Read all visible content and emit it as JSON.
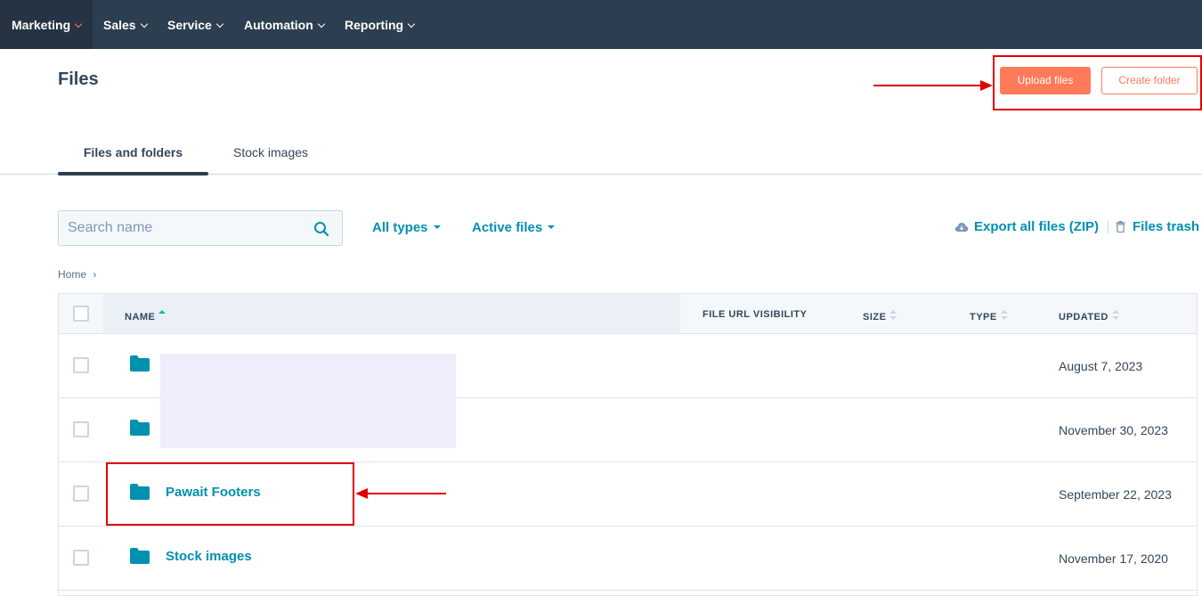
{
  "nav": {
    "items": [
      {
        "label": "Marketing"
      },
      {
        "label": "Sales"
      },
      {
        "label": "Service"
      },
      {
        "label": "Automation"
      },
      {
        "label": "Reporting"
      }
    ]
  },
  "header": {
    "title": "Files",
    "upload_label": "Upload files",
    "create_folder_label": "Create folder"
  },
  "tabs": [
    {
      "label": "Files and folders",
      "active": true
    },
    {
      "label": "Stock images",
      "active": false
    }
  ],
  "toolbar": {
    "search_placeholder": "Search name",
    "type_filter": "All types",
    "status_filter": "Active files",
    "export_label": "Export all files (ZIP)",
    "trash_label": "Files trash"
  },
  "breadcrumb": {
    "home": "Home",
    "separator": "›"
  },
  "table": {
    "columns": {
      "name": "NAME",
      "visibility": "FILE URL VISIBILITY",
      "size": "SIZE",
      "type": "TYPE",
      "updated": "UPDATED"
    },
    "rows": [
      {
        "name": "",
        "updated": "August 7, 2023"
      },
      {
        "name": "",
        "updated": "November 30, 2023"
      },
      {
        "name": "Pawait Footers",
        "updated": "September 22, 2023"
      },
      {
        "name": "Stock images",
        "updated": "November 17, 2020"
      }
    ]
  },
  "colors": {
    "nav_bg": "#2d3e50",
    "accent": "#ff7a59",
    "link": "#0091ae",
    "annotation": "#e10000",
    "folder": "#0091ae"
  }
}
